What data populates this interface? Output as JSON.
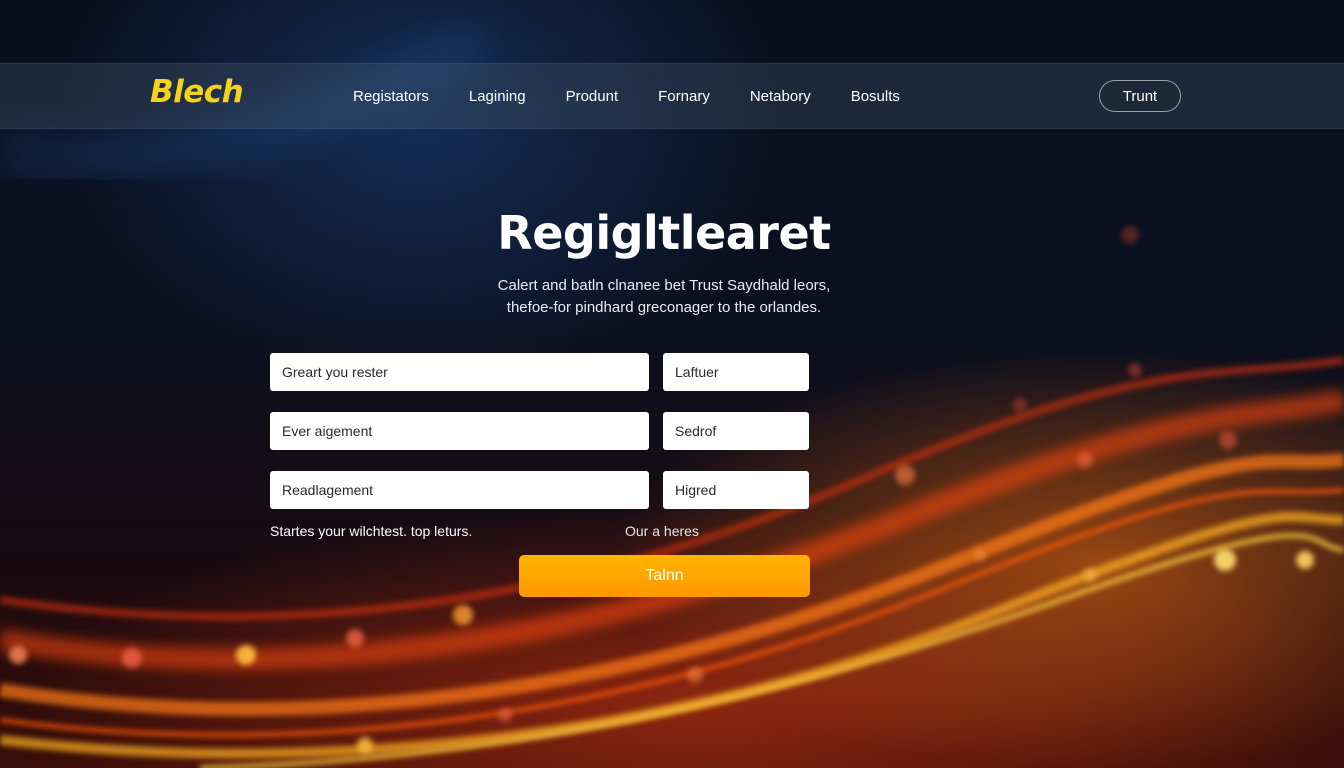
{
  "brand": {
    "logo_text": "Blech",
    "accent_color": "#f6d21e"
  },
  "nav": {
    "links": [
      "Registators",
      "Lagining",
      "Produnt",
      "Fornary",
      "Netabory",
      "Bosults"
    ],
    "button_label": "Trunt"
  },
  "hero": {
    "title": "Regigltlearet",
    "subtitle_lines": [
      "Calert and batln clnanee bet Trust Saydhald leors,",
      "thefoe-for pindhard greconager to the orlandes."
    ]
  },
  "form": {
    "fields": [
      {
        "value": "Greart you rester"
      },
      {
        "value": "Laftuer"
      },
      {
        "value": "Ever aigement"
      },
      {
        "value": "Sedrof"
      },
      {
        "value": "Readlagement"
      },
      {
        "value": "Higred"
      }
    ],
    "terms_text": "Startes your wilchtest. top leturs.",
    "aux_link": "Our a heres",
    "submit_label": "Talnn",
    "submit_color": "#ffa000"
  }
}
